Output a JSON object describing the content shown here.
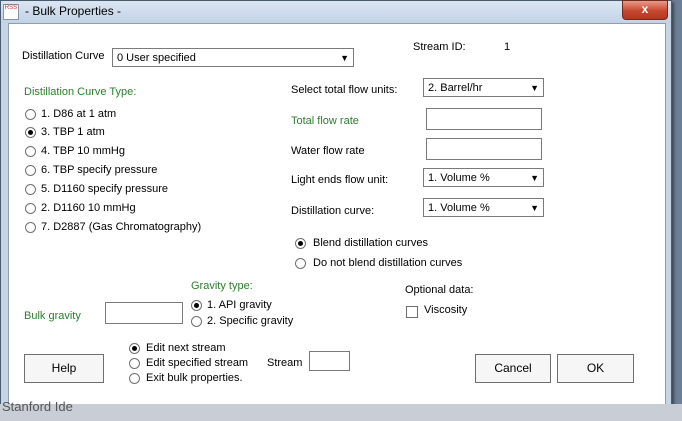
{
  "window": {
    "title": "- Bulk Properties -",
    "close_glyph": "x",
    "icon_label": "RSS"
  },
  "distillation_curve": {
    "label": "Distillation Curve",
    "selected": "0 User specified"
  },
  "stream_id": {
    "label": "Stream ID:",
    "value": "1"
  },
  "curve_type": {
    "heading": "Distillation Curve Type:",
    "options": [
      {
        "label": "1. D86 at 1 atm",
        "selected": false
      },
      {
        "label": "3. TBP 1 atm",
        "selected": true
      },
      {
        "label": "4. TBP 10 mmHg",
        "selected": false
      },
      {
        "label": "6. TBP specify pressure",
        "selected": false
      },
      {
        "label": "5. D1160 specify pressure",
        "selected": false
      },
      {
        "label": "2. D1160 10 mmHg",
        "selected": false
      },
      {
        "label": "7. D2887 (Gas Chromatography)",
        "selected": false
      }
    ]
  },
  "flow": {
    "units_label": "Select total flow units:",
    "units_value": "2. Barrel/hr",
    "total_rate_label": "Total flow rate",
    "total_rate_value": "",
    "water_rate_label": "Water flow rate",
    "water_rate_value": "",
    "light_ends_label": "Light ends flow unit:",
    "light_ends_value": "1. Volume %",
    "dist_curve_label": "Distillation curve:",
    "dist_curve_value": "1. Volume %"
  },
  "blend": {
    "options": [
      {
        "label": "Blend distillation curves",
        "selected": true
      },
      {
        "label": "Do not blend distillation curves",
        "selected": false
      }
    ]
  },
  "gravity": {
    "bulk_label": "Bulk gravity",
    "bulk_value": "",
    "type_heading": "Gravity type:",
    "options": [
      {
        "label": "1. API gravity",
        "selected": true
      },
      {
        "label": "2. Specific gravity",
        "selected": false
      }
    ]
  },
  "optional": {
    "heading": "Optional data:",
    "viscosity_label": "Viscosity",
    "viscosity_checked": false
  },
  "next_action": {
    "options": [
      {
        "label": "Edit next stream",
        "selected": true
      },
      {
        "label": "Edit specified stream",
        "selected": false
      },
      {
        "label": "Exit bulk properties.",
        "selected": false
      }
    ],
    "stream_label": "Stream",
    "stream_value": ""
  },
  "buttons": {
    "help": "Help",
    "cancel": "Cancel",
    "ok": "OK"
  },
  "taskbar": {
    "text": "Stanford Ide"
  },
  "colors": {
    "green_label": "#2d7d2d",
    "window_frame": "#c5d4e6",
    "close_button": "#c6472f"
  }
}
